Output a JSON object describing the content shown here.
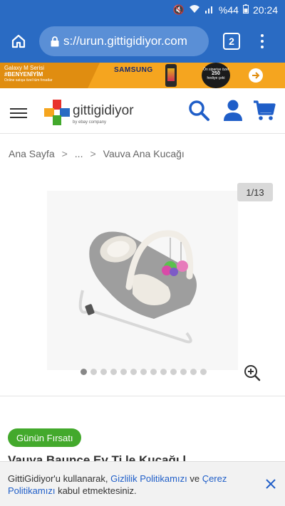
{
  "status_bar": {
    "battery": "%44",
    "time": "20:24"
  },
  "browser": {
    "url": "s://urun.gittigidiyor.com",
    "tab_count": "2"
  },
  "banner": {
    "line1": "Galaxy M Serisi",
    "line2": "#BENYENİYİM",
    "line3": "Online satışa özel tüm fırsatlar",
    "brand": "SAMSUNG",
    "badge_line1": "Ön siparişe özel",
    "badge_amount": "250",
    "badge_line3": "hediye çeki"
  },
  "header": {
    "logo_text": "gittigidiyor",
    "logo_sub": "by ebay company"
  },
  "breadcrumb": {
    "home": "Ana Sayfa",
    "sep1": ">",
    "ellipsis": "...",
    "sep2": ">",
    "current": "Vauva Ana Kucağı"
  },
  "gallery": {
    "counter": "1/13",
    "total_dots": 13,
    "active_dot": 1
  },
  "product": {
    "deal_label": "Günün Fırsatı",
    "title_peek": "Vauva Baunce Ev Ti  le  Kucağı  l"
  },
  "cookie": {
    "text1": "GittiGidiyor'u kullanarak, ",
    "link1": "Gizlilik Politikamızı",
    "text2": " ve ",
    "link2": "Çerez Politikamızı",
    "text3": " kabul etmektesiniz."
  },
  "colors": {
    "brand_blue": "#2a6bc3",
    "icon_blue": "#1f5ec8",
    "deal_green": "#43a92c",
    "banner_orange": "#f5a51f"
  }
}
